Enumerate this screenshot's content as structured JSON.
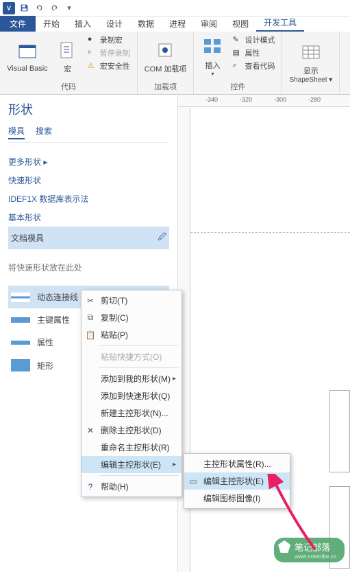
{
  "titlebar": {
    "app_abbr": "V"
  },
  "tabs": {
    "file": "文件",
    "items": [
      "开始",
      "插入",
      "设计",
      "数据",
      "进程",
      "审阅",
      "视图",
      "开发工具"
    ]
  },
  "ribbon": {
    "code": {
      "label": "代码",
      "vb": "Visual Basic",
      "macro": "宏",
      "record": "录制宏",
      "pause": "暂停录制",
      "security": "宏安全性"
    },
    "addins": {
      "label": "加载项",
      "com": "COM 加载项"
    },
    "controls": {
      "label": "控件",
      "insert": "插入",
      "design": "设计模式",
      "props": "属性",
      "view_code": "查看代码"
    },
    "shapesheet": {
      "display": "显示",
      "ss": "ShapeSheet"
    }
  },
  "shapes_panel": {
    "title": "形状",
    "tabs": {
      "stencil": "模具",
      "search": "搜索"
    },
    "more": "更多形状",
    "quick": "快速形状",
    "idef": "IDEF1X 数据库表示法",
    "basic": "基本形状",
    "doc_stencil": "文档模具",
    "hint": "将快速形状放在此处",
    "items": {
      "dynamic_connector": "动态连接线",
      "primary_key": "主键属性",
      "attribute": "属性",
      "rectangle": "矩形"
    }
  },
  "ruler": {
    "n340": "-340",
    "n320": "-320",
    "n300": "-300",
    "n280": "-280"
  },
  "context_menu": {
    "cut": "剪切(T)",
    "copy": "复制(C)",
    "paste": "粘贴(P)",
    "paste_shortcut": "粘贴快捷方式(O)",
    "add_my": "添加到我的形状(M)",
    "add_quick": "添加到快速形状(Q)",
    "new_master": "新建主控形状(N)...",
    "del_master": "删除主控形状(D)",
    "rename_master": "重命名主控形状(R)",
    "edit_master": "编辑主控形状(E)",
    "help": "帮助(H)"
  },
  "submenu": {
    "master_props": "主控形状属性(R)...",
    "edit_master_shape": "编辑主控形状(E)",
    "edit_icon": "编辑图标图像(I)"
  },
  "watermark": {
    "text": "笔记部落",
    "sub": "www.notetribe.cn"
  }
}
